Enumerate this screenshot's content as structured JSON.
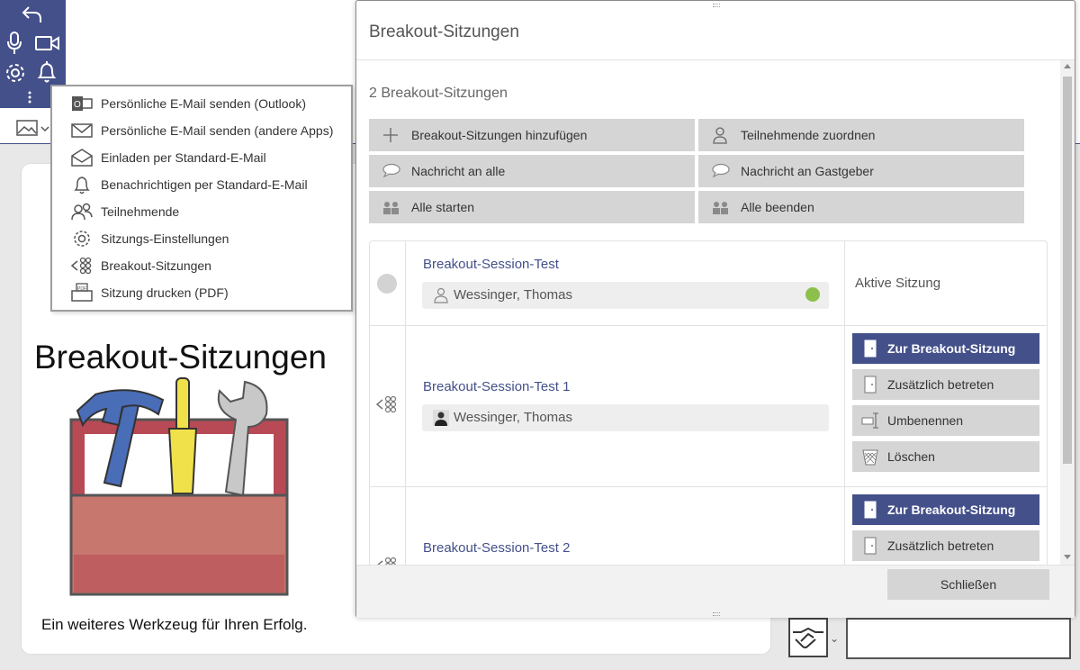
{
  "toolbar": {
    "icons": [
      "undo-icon",
      "microphone-icon",
      "camera-icon",
      "gear-icon",
      "bell-icon",
      "more-vertical-icon"
    ]
  },
  "menu": {
    "items": [
      {
        "label": "Persönliche E-Mail senden (Outlook)",
        "icon": "outlook-icon"
      },
      {
        "label": "Persönliche E-Mail senden (andere Apps)",
        "icon": "envelope-icon"
      },
      {
        "label": "Einladen per Standard-E-Mail",
        "icon": "open-envelope-icon"
      },
      {
        "label": "Benachrichtigen per Standard-E-Mail",
        "icon": "bell-icon"
      },
      {
        "label": "Teilnehmende",
        "icon": "users-icon"
      },
      {
        "label": "Sitzungs-Einstellungen",
        "icon": "gear-icon"
      },
      {
        "label": "Breakout-Sitzungen",
        "icon": "breakout-icon"
      },
      {
        "label": "Sitzung drucken (PDF)",
        "icon": "printer-pdf-icon"
      }
    ]
  },
  "slide": {
    "title": "Breakout-Sitzungen",
    "caption": "Ein weiteres Werkzeug für Ihren Erfolg.",
    "colors": {
      "toolbox_red": "#b84a55",
      "toolbox_inner": "#c8776e",
      "hammer_blue": "#4a6db8",
      "screwdriver_yellow": "#f0e14a",
      "wrench_gray": "#c8c8c8"
    }
  },
  "modal": {
    "title": "Breakout-Sitzungen",
    "count_label": "2 Breakout-Sitzungen",
    "actions": [
      {
        "label": "Breakout-Sitzungen hinzufügen",
        "icon": "plus-icon"
      },
      {
        "label": "Teilnehmende zuordnen",
        "icon": "user-icon"
      },
      {
        "label": "Nachricht an alle",
        "icon": "speech-bubble-icon"
      },
      {
        "label": "Nachricht an Gastgeber",
        "icon": "speech-bubble-icon"
      },
      {
        "label": "Alle starten",
        "icon": "group-start-icon"
      },
      {
        "label": "Alle beenden",
        "icon": "group-end-icon"
      }
    ],
    "sessions": [
      {
        "name": "Breakout-Session-Test",
        "member": "Wessinger, Thomas",
        "status": "Aktive Sitzung",
        "online": true
      },
      {
        "name": "Breakout-Session-Test 1",
        "member": "Wessinger, Thomas",
        "buttons": [
          {
            "label": "Zur Breakout-Sitzung",
            "icon": "door-icon",
            "primary": true
          },
          {
            "label": "Zusätzlich betreten",
            "icon": "door-icon",
            "primary": false
          },
          {
            "label": "Umbenennen",
            "icon": "rename-icon",
            "primary": false
          },
          {
            "label": "Löschen",
            "icon": "trash-icon",
            "primary": false
          }
        ]
      },
      {
        "name": "Breakout-Session-Test 2",
        "buttons": [
          {
            "label": "Zur Breakout-Sitzung",
            "icon": "door-icon",
            "primary": true
          },
          {
            "label": "Zusätzlich betreten",
            "icon": "door-icon",
            "primary": false
          }
        ]
      }
    ],
    "close_label": "Schließen",
    "colors": {
      "accent": "#44508a",
      "online": "#8cc04b",
      "button_gray": "#d5d5d5"
    }
  }
}
